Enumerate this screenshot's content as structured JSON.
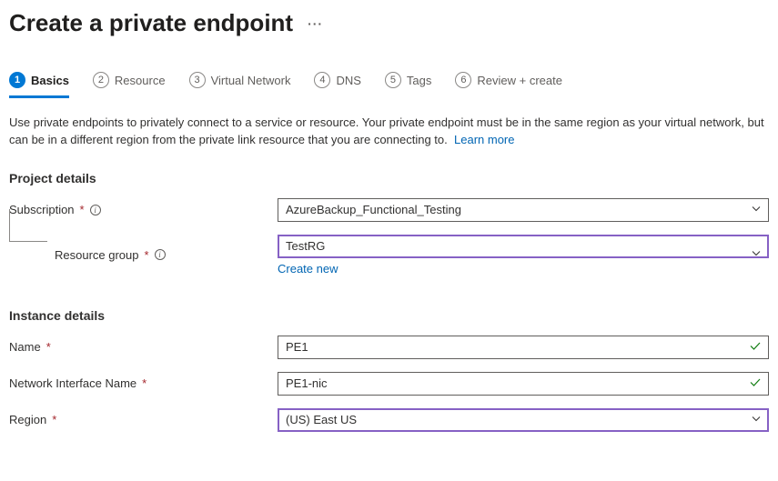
{
  "page_title": "Create a private endpoint",
  "tabs": [
    {
      "num": "1",
      "label": "Basics"
    },
    {
      "num": "2",
      "label": "Resource"
    },
    {
      "num": "3",
      "label": "Virtual Network"
    },
    {
      "num": "4",
      "label": "DNS"
    },
    {
      "num": "5",
      "label": "Tags"
    },
    {
      "num": "6",
      "label": "Review + create"
    }
  ],
  "description": "Use private endpoints to privately connect to a service or resource. Your private endpoint must be in the same region as your virtual network, but can be in a different region from the private link resource that you are connecting to.",
  "learn_more": "Learn more",
  "sections": {
    "project": {
      "heading": "Project details",
      "subscription_label": "Subscription",
      "subscription_value": "AzureBackup_Functional_Testing",
      "rg_label": "Resource group",
      "rg_value": "TestRG",
      "create_new": "Create new"
    },
    "instance": {
      "heading": "Instance details",
      "name_label": "Name",
      "name_value": "PE1",
      "nic_label": "Network Interface Name",
      "nic_value": "PE1-nic",
      "region_label": "Region",
      "region_value": "(US) East US"
    }
  }
}
